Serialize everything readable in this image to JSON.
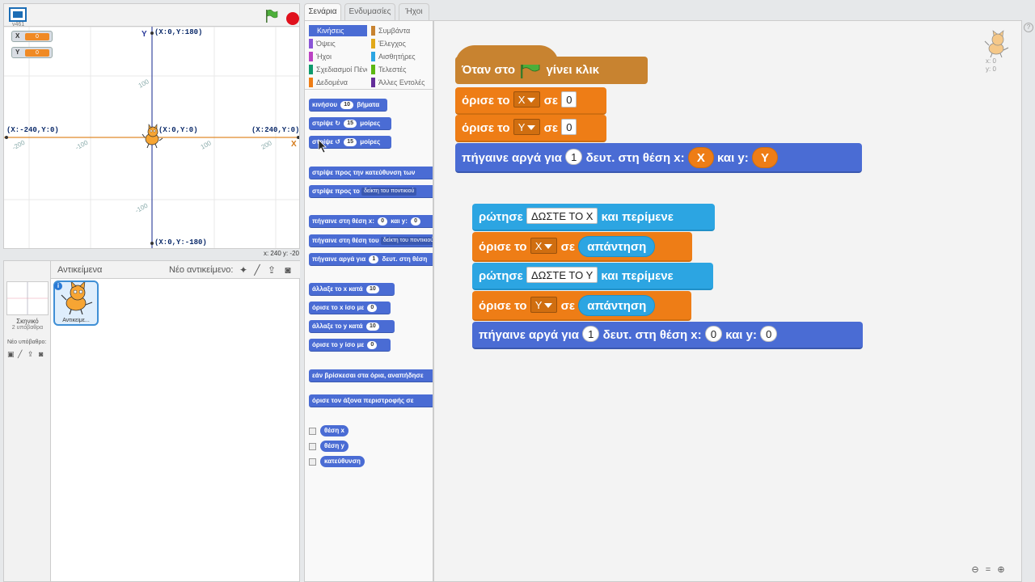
{
  "stage": {
    "version": "v461",
    "coords": {
      "top": "(X:0,Y:180)",
      "bottom": "(X:0,Y:-180)",
      "left": "(X:-240,Y:0)",
      "right": "(X:240,Y:0)",
      "center": "(X:0,Y:0)"
    },
    "axis_numbers": {
      "x_neg200": "-200",
      "x_neg100": "-100",
      "x_100": "100",
      "x_200": "200",
      "y_100": "100",
      "y_neg100": "-100"
    },
    "x_axis_label": "X",
    "y_axis_label": "Y",
    "monitors": [
      {
        "name": "X",
        "value": "0"
      },
      {
        "name": "Y",
        "value": "0"
      }
    ],
    "mouse_readout": "x: 240   y: -20"
  },
  "sprites_panel": {
    "title": "Αντικείμενα",
    "new_sprite_label": "Νέο αντικείμενο:",
    "stage_name": "Σκηνικό",
    "stage_backdrops": "2 υπόβαθρα",
    "new_backdrop_label": "Νέο υπόβαθρο:",
    "sprite_name": "Αντικείμε...",
    "sprite_info": "i"
  },
  "tabs": [
    {
      "label": "Σενάρια",
      "active": true
    },
    {
      "label": "Ενδυμασίες",
      "active": false
    },
    {
      "label": "Ήχοι",
      "active": false
    }
  ],
  "categories": [
    {
      "label": "Κινήσεις",
      "color": "#4a6cd4",
      "active": true
    },
    {
      "label": "Όψεις",
      "color": "#8a55d7"
    },
    {
      "label": "Ήχοι",
      "color": "#bb42c3"
    },
    {
      "label": "Σχεδιασμοί Πένας",
      "color": "#0e9a6c"
    },
    {
      "label": "Δεδομένα",
      "color": "#ee7d16"
    },
    {
      "label": "Συμβάντα",
      "color": "#c88330"
    },
    {
      "label": "Έλεγχος",
      "color": "#e1a91a"
    },
    {
      "label": "Αισθητήρες",
      "color": "#2ca5e2"
    },
    {
      "label": "Τελεστές",
      "color": "#5cb712"
    },
    {
      "label": "Άλλες Εντολές",
      "color": "#632d99"
    }
  ],
  "palette_blocks": {
    "move": {
      "pre": "κινήσου",
      "val": "10",
      "post": "βήματα"
    },
    "turn_cw": {
      "pre": "στρίψε ↻",
      "val": "15",
      "post": "μοίρες"
    },
    "turn_ccw": {
      "pre": "στρίψε ↺",
      "val": "15",
      "post": "μοίρες"
    },
    "point_dir": {
      "text": "στρίψε προς την κατεύθυνση των"
    },
    "point_towards": {
      "pre": "στρίψε προς το",
      "drop": "δείκτη του ποντικιού"
    },
    "goto_xy": {
      "pre": "πήγαινε στη θέση x:",
      "val1": "0",
      "mid": "και y:",
      "val2": "0"
    },
    "goto_target": {
      "pre": "πήγαινε στη θέση του",
      "drop": "δείκτη του ποντικιού"
    },
    "glide": {
      "pre": "πήγαινε αργά για",
      "val": "1",
      "post": "δευτ. στη θέση"
    },
    "change_x": {
      "pre": "άλλαξε το x κατά",
      "val": "10"
    },
    "set_x": {
      "pre": "όρισε το x ίσο με",
      "val": "0"
    },
    "change_y": {
      "pre": "άλλαξε το y κατά",
      "val": "10"
    },
    "set_y": {
      "pre": "όρισε το y ίσο με",
      "val": "0"
    },
    "bounce": {
      "text": "εάν βρίσκεσαι στα όρια, αναπήδησε"
    },
    "rotation_style": {
      "text": "όρισε τον άξονα περιστροφής σε"
    },
    "reporters": [
      "θέση x",
      "θέση y",
      "κατεύθυνση"
    ]
  },
  "script1": {
    "hat": {
      "pre": "Όταν στο",
      "post": "γίνει κλικ"
    },
    "set_x": {
      "word1": "όρισε το",
      "var": "X",
      "word2": "σε",
      "val": "0"
    },
    "set_y": {
      "word1": "όρισε το",
      "var": "Y",
      "word2": "σε",
      "val": "0"
    },
    "glide": {
      "pre": "πήγαινε αργά για",
      "secs": "1",
      "mid": "δευτ. στη θέση x:",
      "x": "X",
      "and_y": "και y:",
      "y": "Y"
    }
  },
  "script2": {
    "ask_x": {
      "pre": "ρώτησε",
      "val": "ΔΩΣΤΕ ΤΟ Χ",
      "post": "και περίμενε"
    },
    "set_x": {
      "word1": "όρισε το",
      "var": "X",
      "word2": "σε",
      "reporter": "απάντηση"
    },
    "ask_y": {
      "pre": "ρώτησε",
      "val": "ΔΩΣΤΕ ΤΟ Υ",
      "post": "και περίμενε"
    },
    "set_y": {
      "word1": "όρισε το",
      "var": "Y",
      "word2": "σε",
      "reporter": "απάντηση"
    },
    "glide": {
      "pre": "πήγαινε αργά για",
      "secs": "1",
      "mid": "δευτ. στη θέση x:",
      "x": "0",
      "and_y": "και y:",
      "y": "0"
    }
  },
  "sprite_corner": {
    "x": "x: 0",
    "y": "y: 0"
  },
  "help": "?"
}
